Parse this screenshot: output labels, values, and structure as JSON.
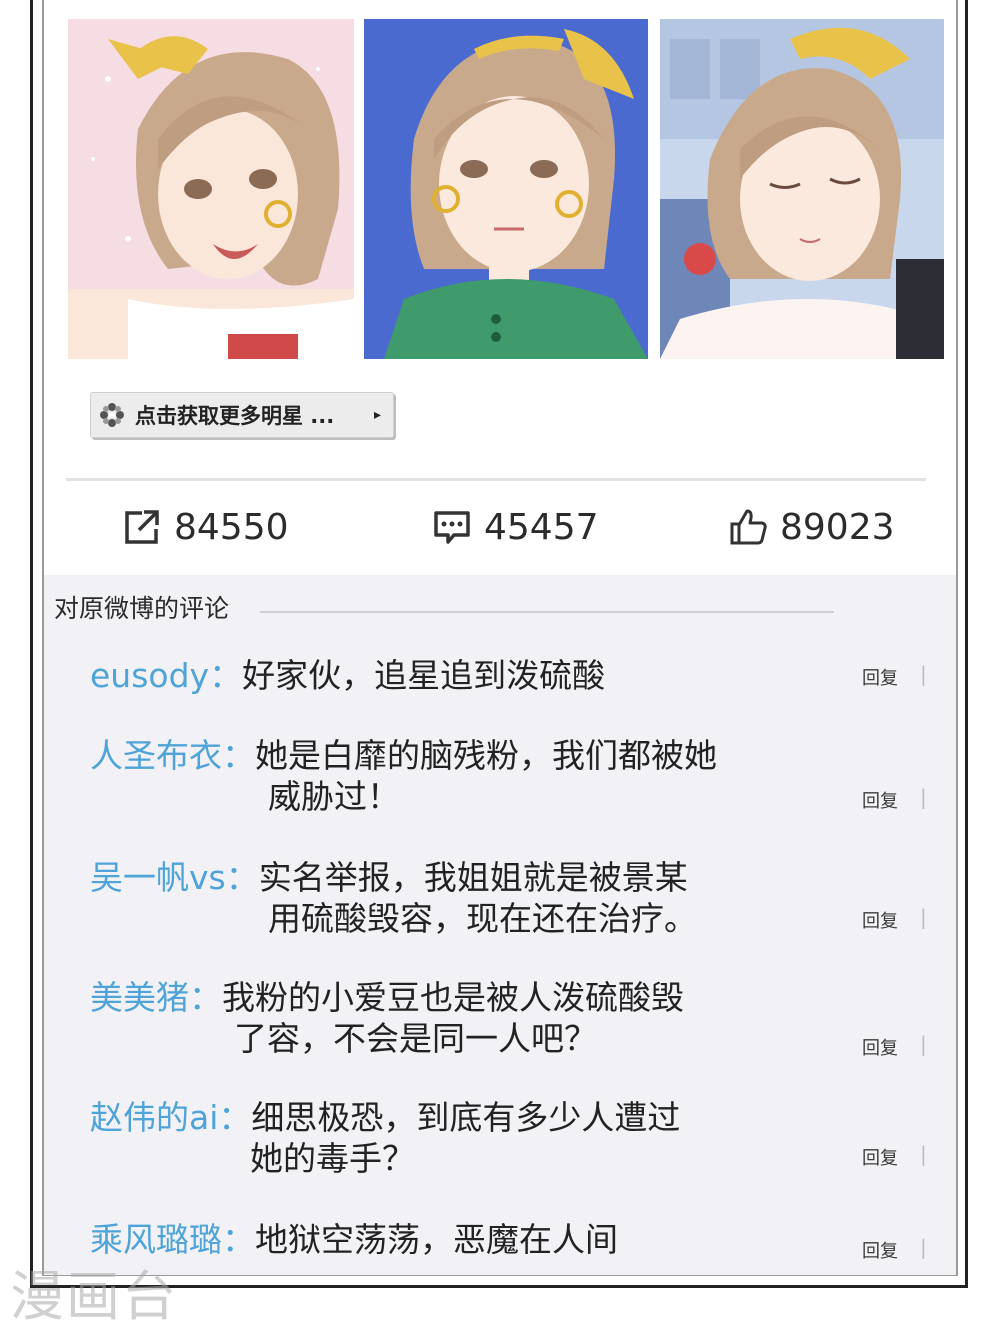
{
  "promo": {
    "label": "点击获取更多明星 ...",
    "arrow": "▸"
  },
  "stats": {
    "repost_count": "84550",
    "comment_count": "45457",
    "like_count": "89023"
  },
  "comments_section": {
    "title": "对原微博的评论",
    "reply_label": "回复",
    "items": [
      {
        "user": "eusody：",
        "line1": "好家伙，追星追到泼硫酸",
        "line2": ""
      },
      {
        "user": "人圣布衣：",
        "line1": "她是白靡的脑残粉，我们都被她",
        "line2": "威胁过！"
      },
      {
        "user": "吴一帆vs：",
        "line1": "实名举报，我姐姐就是被景某",
        "line2": "用硫酸毁容，现在还在治疗。"
      },
      {
        "user": "美美猪：",
        "line1": "我粉的小爱豆也是被人泼硫酸毁",
        "line2": "了容，不会是同一人吧？"
      },
      {
        "user": "赵伟的ai：",
        "line1": "细思极恐，到底有多少人遭过",
        "line2": "她的毒手？"
      },
      {
        "user": "乘风璐璐：",
        "line1": "地狱空荡荡，恶魔在人间",
        "line2": ""
      }
    ]
  },
  "watermark": "漫画台",
  "colors": {
    "username": "#4ea3d8",
    "comments_bg": "#f2f2f6",
    "panel2_bg": "#4a6ad0",
    "hair": "#c9a98c",
    "bow": "#e9c24a"
  }
}
